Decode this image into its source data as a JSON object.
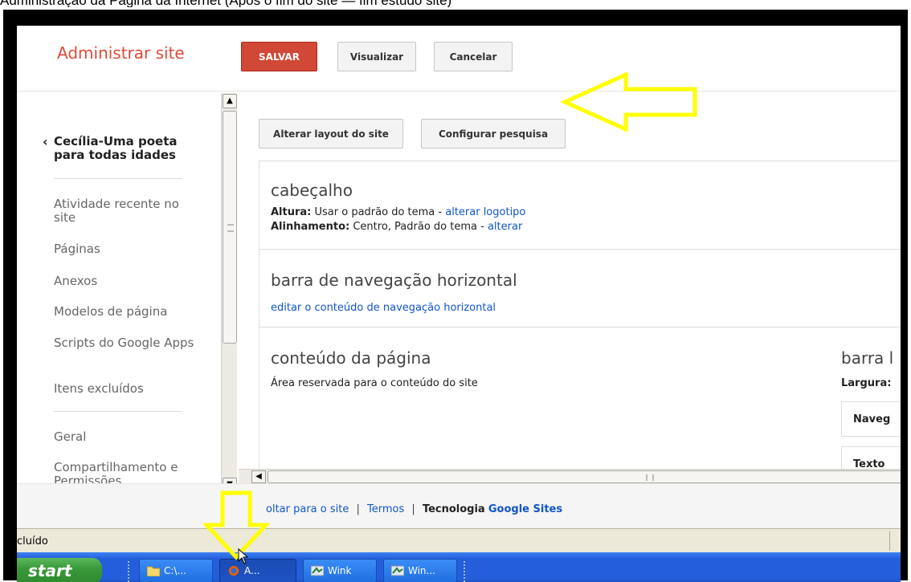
{
  "caption": "Administração da Página da Internet (Após o fim do site — fim estudo site)",
  "header": {
    "title": "Administrar site",
    "save": "SALVAR",
    "preview": "Visualizar",
    "cancel": "Cancelar"
  },
  "sidebar": {
    "site_name": "Cecília-Uma poeta para todas idades",
    "items": [
      "Atividade recente no site",
      "Páginas",
      "Anexos",
      "Modelos de página",
      "Scripts do Google Apps",
      "Itens excluídos",
      "Geral",
      "Compartilhamento e Permissões"
    ]
  },
  "main": {
    "btn_layout": "Alterar layout do site",
    "btn_search": "Configurar pesquisa",
    "header_section": {
      "title": "cabeçalho",
      "height_label": "Altura:",
      "height_value": "Usar o padrão do tema -",
      "height_link": "alterar logotipo",
      "align_label": "Alinhamento:",
      "align_value": "Centro, Padrão do tema -",
      "align_link": "alterar"
    },
    "nav_section": {
      "title": "barra de navegação horizontal",
      "link": "editar o conteúdo de navegação horizontal"
    },
    "content_section": {
      "title": "conteúdo da página",
      "desc": "Área reservada para o conteúdo do site",
      "side_title": "barra l",
      "side_width": "Largura:",
      "side_box1": "Naveg",
      "side_box2": "Texto"
    }
  },
  "footer": {
    "back": "oltar para o site",
    "terms": "Termos",
    "tech": "Tecnologia",
    "google_sites": "Google Sites",
    "sep": "|"
  },
  "status": {
    "text": "cluído"
  },
  "taskbar": {
    "start": "start",
    "tasks": [
      "C:\\...",
      "A...",
      "Wink",
      "Win..."
    ]
  },
  "colors": {
    "accent_red": "#dd4b39",
    "link_blue": "#1155cc",
    "arrow_yellow": "#ffff00"
  }
}
